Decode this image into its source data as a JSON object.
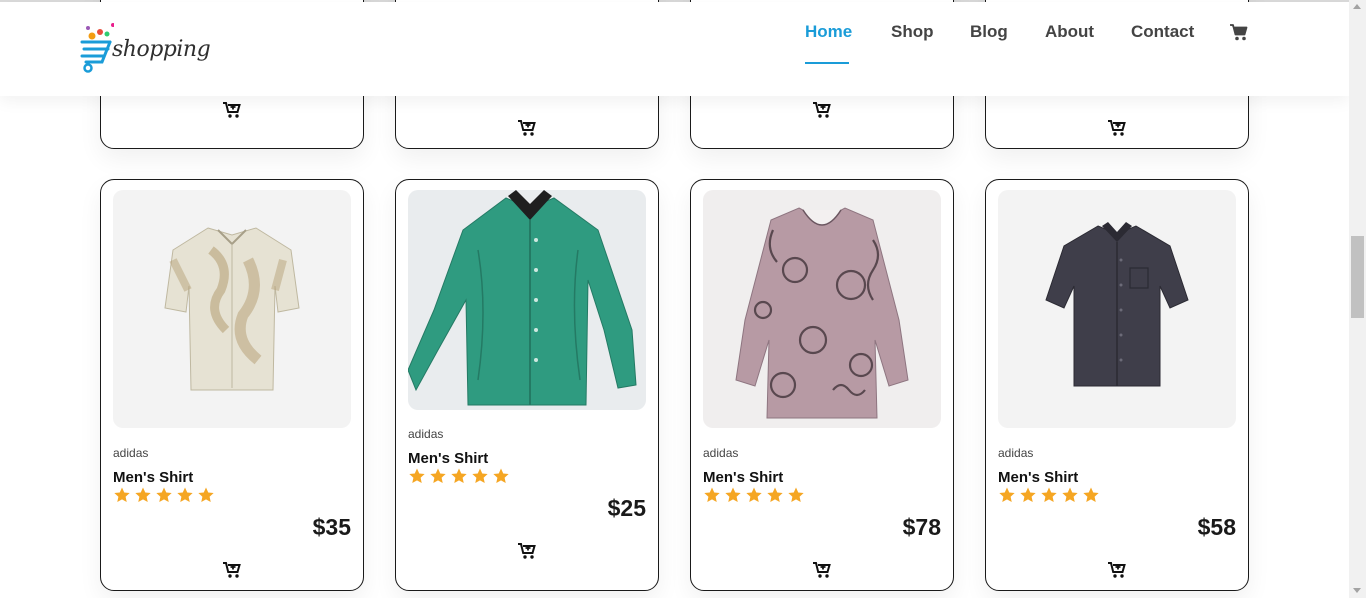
{
  "header": {
    "logo_text": "shopping",
    "nav": [
      {
        "label": "Home",
        "active": true
      },
      {
        "label": "Shop",
        "active": false
      },
      {
        "label": "Blog",
        "active": false
      },
      {
        "label": "About",
        "active": false
      },
      {
        "label": "Contact",
        "active": false
      }
    ],
    "cart_icon": "cart-icon"
  },
  "colors": {
    "accent": "#1a9cd8",
    "star": "#f5a623",
    "card_border": "#1a1a1a",
    "text": "#1a1a1a"
  },
  "products": [
    {
      "brand": "adidas",
      "title": "Men's Shirt",
      "rating": 5,
      "price": "$35",
      "image": "beige-printed-short-sleeve-shirt"
    },
    {
      "brand": "adidas",
      "title": "Men's Shirt",
      "rating": 5,
      "price": "$25",
      "image": "green-long-sleeve-shirt"
    },
    {
      "brand": "adidas",
      "title": "Men's Shirt",
      "rating": 5,
      "price": "$78",
      "image": "mauve-cat-print-blouse"
    },
    {
      "brand": "adidas",
      "title": "Men's Shirt",
      "rating": 5,
      "price": "$58",
      "image": "dark-grey-short-sleeve-shirt"
    }
  ]
}
